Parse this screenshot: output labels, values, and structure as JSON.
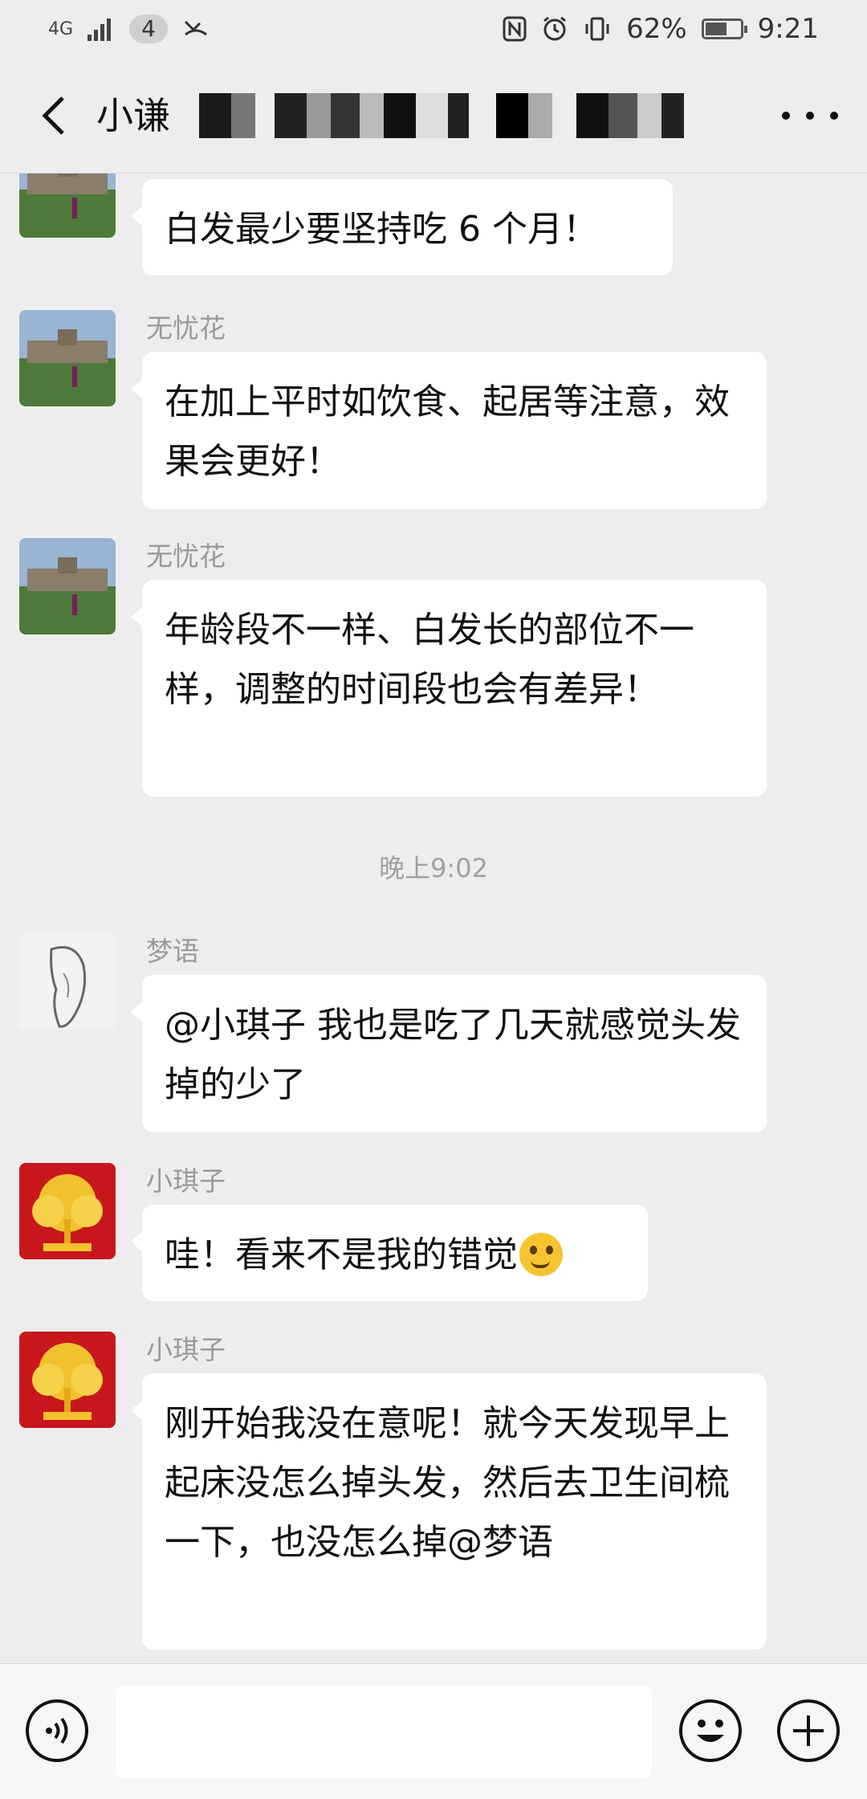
{
  "status_bar": {
    "network": "4G",
    "signal_icon": "signal-icon",
    "notification_count": "4",
    "nfc_icon": "nfc-icon",
    "alarm_icon": "alarm-icon",
    "vibrate_icon": "vibrate-icon",
    "battery_percent": "62%",
    "battery_level": 0.62,
    "time": "9:21"
  },
  "header": {
    "title": "小谦",
    "back_icon": "back-chevron-icon",
    "more_icon": "more-dots-icon"
  },
  "messages": [
    {
      "sender": "",
      "text": "白发最少要坚持吃 6 个月！",
      "avatar": "palace-photo-avatar"
    },
    {
      "sender": "无忧花",
      "text": "在加上平时如饮食、起居等注意，效果会更好！",
      "avatar": "palace-photo-avatar"
    },
    {
      "sender": "无忧花",
      "text": "年龄段不一样、白发长的部位不一样，调整的时间段也会有差异！",
      "avatar": "palace-photo-avatar"
    },
    {
      "sender": "梦语",
      "text": "@小琪子  我也是吃了几天就感觉头发掉的少了",
      "avatar": "sketch-portrait-avatar"
    },
    {
      "sender": "小琪子",
      "text": "哇！看来不是我的错觉",
      "emoji": "thinking-face-emoji",
      "avatar": "golden-tree-avatar"
    },
    {
      "sender": "小琪子",
      "text": "刚开始我没在意呢！就今天发现早上起床没怎么掉头发，然后去卫生间梳一下，也没怎么掉@梦语",
      "avatar": "golden-tree-avatar"
    }
  ],
  "timestamp": "晚上9:02",
  "input_bar": {
    "voice_icon": "voice-icon",
    "input_value": "",
    "emoji_icon": "emoji-icon",
    "plus_icon": "plus-icon"
  },
  "colors": {
    "background": "#ededed",
    "bubble": "#ffffff",
    "meta_text": "#9a9a9a",
    "red_avatar": "#c8161d",
    "gold": "#f2c12e"
  }
}
